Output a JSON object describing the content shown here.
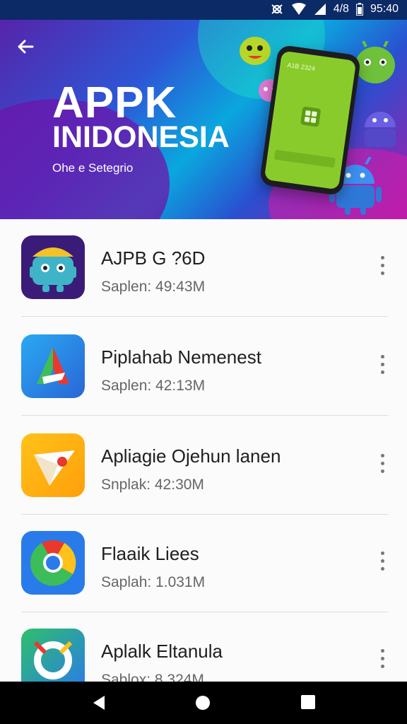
{
  "status_bar": {
    "time": "95:40",
    "signal_text": "4/8"
  },
  "hero": {
    "title_line1": "APPK",
    "title_line2": "INIDONESIA",
    "subtitle": "Ohe e Setegrio",
    "phone_header": "A1B 2324"
  },
  "apps": [
    {
      "name": "AJPB G ?6D",
      "meta": "Saplen: 49:43M",
      "icon": "android-robot-icon"
    },
    {
      "name": "Piplahab Nemenest",
      "meta": "Saplen: 42:13M",
      "icon": "triangle-a-icon"
    },
    {
      "name": "Apliagie Ojehun lanen",
      "meta": "Snplak: 42:30M",
      "icon": "paper-plane-icon"
    },
    {
      "name": "Flaaik Liees",
      "meta": "Saplah: 1.031M",
      "icon": "chrome-icon"
    },
    {
      "name": "Aplalk Eltanula",
      "meta": "Sablox: 8.324M",
      "icon": "ring-icon"
    }
  ],
  "colors": {
    "hero_blue": "#0aa7de",
    "hero_purple": "#5a1fa6",
    "status_bg": "#0b2a66"
  }
}
